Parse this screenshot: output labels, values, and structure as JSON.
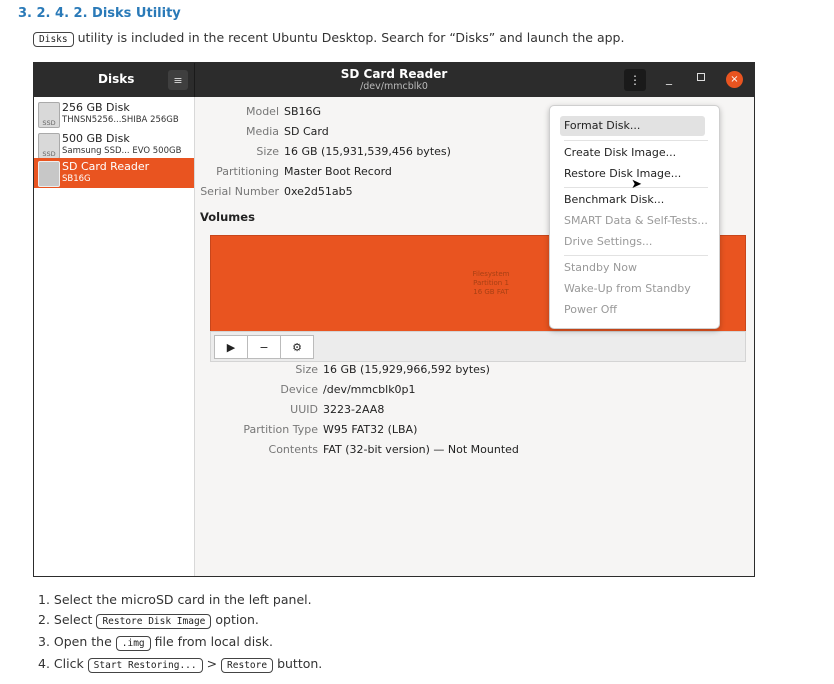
{
  "heading": "3. 2. 4. 2. Disks Utility",
  "intro": {
    "code": "Disks",
    "text": " utility is included in the recent Ubuntu Desktop. Search for “Disks” and launch the app."
  },
  "window": {
    "app_name": "Disks",
    "title": "SD Card Reader",
    "subtitle": "/dev/mmcblk0",
    "menu_icon": "hamburger-icon",
    "kebab_icon": "vertical-dots-icon",
    "close_glyph": "×",
    "minimize_glyph": "_",
    "accent": "#e95420"
  },
  "sidebar": {
    "drives": [
      {
        "name": "256 GB Disk",
        "model": "THNSN5256...SHIBA 256GB",
        "icon_text": "SSD"
      },
      {
        "name": "500 GB Disk",
        "model": "Samsung SSD... EVO 500GB",
        "icon_text": "SSD"
      },
      {
        "name": "SD Card Reader",
        "model": "SB16G",
        "icon_text": ""
      }
    ]
  },
  "drive_info": [
    {
      "label": "Model",
      "value": "SB16G"
    },
    {
      "label": "Media",
      "value": "SD Card"
    },
    {
      "label": "Size",
      "value": "16 GB (15,931,539,456 bytes)"
    },
    {
      "label": "Partitioning",
      "value": "Master Boot Record"
    },
    {
      "label": "Serial Number",
      "value": "0xe2d51ab5"
    }
  ],
  "volumes": {
    "title": "Volumes",
    "partition_label": [
      "Filesystem",
      "Partition 1",
      "16 GB FAT"
    ],
    "tools": [
      "▶",
      "−",
      "⚙"
    ]
  },
  "partition_info": [
    {
      "label": "Size",
      "value": "16 GB (15,929,966,592 bytes)"
    },
    {
      "label": "Device",
      "value": "/dev/mmcblk0p1"
    },
    {
      "label": "UUID",
      "value": "3223-2AA8"
    },
    {
      "label": "Partition Type",
      "value": "W95 FAT32 (LBA)"
    },
    {
      "label": "Contents",
      "value": "FAT (32-bit version) — Not Mounted"
    }
  ],
  "menu": {
    "items": [
      {
        "label": "Format Disk...",
        "enabled": true
      },
      {
        "label": "Create Disk Image...",
        "enabled": true
      },
      {
        "label": "Restore Disk Image...",
        "enabled": true
      },
      {
        "label": "Benchmark Disk...",
        "enabled": true
      },
      {
        "label": "SMART Data & Self-Tests...",
        "enabled": false
      },
      {
        "label": "Drive Settings...",
        "enabled": false
      },
      {
        "label": "Standby Now",
        "enabled": false
      },
      {
        "label": "Wake-Up from Standby",
        "enabled": false
      },
      {
        "label": "Power Off",
        "enabled": false
      }
    ]
  },
  "steps": [
    {
      "pre": "1. Select the microSD card in the left panel.",
      "code": "",
      "mid": "",
      "code2": "",
      "post": ""
    },
    {
      "pre": "2. Select ",
      "code": "Restore Disk Image",
      "mid": " option.",
      "code2": "",
      "post": ""
    },
    {
      "pre": "3. Open the ",
      "code": ".img",
      "mid": " file from local disk.",
      "code2": "",
      "post": ""
    },
    {
      "pre": "4. Click ",
      "code": "Start Restoring...",
      "mid": " > ",
      "code2": "Restore",
      "post": " button."
    }
  ]
}
